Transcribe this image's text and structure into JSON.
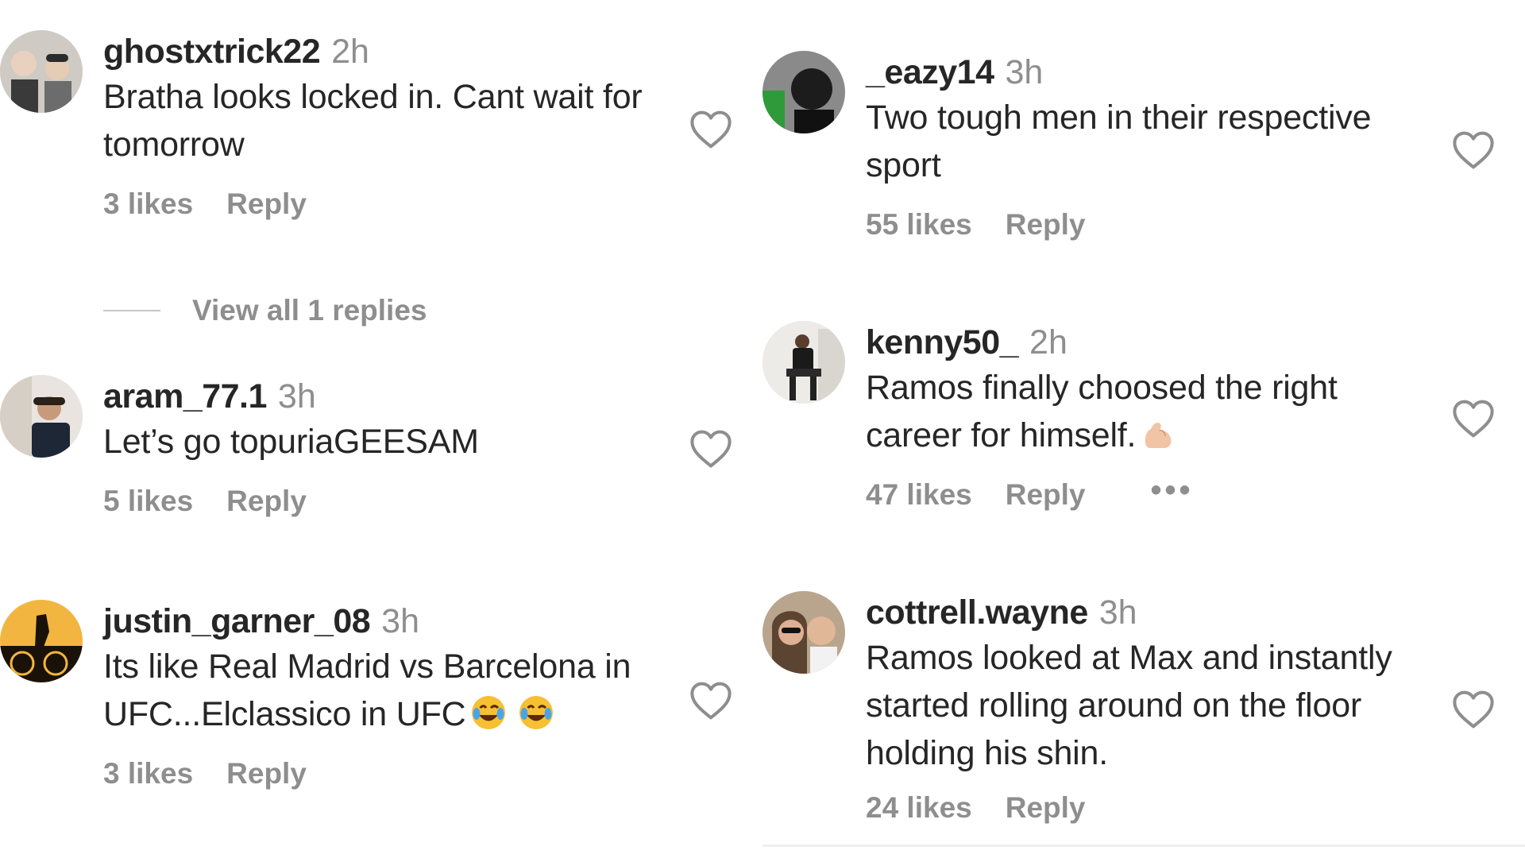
{
  "left_column": {
    "comments": [
      {
        "username": "ghostxtrick22",
        "time": "2h",
        "text": "Bratha looks locked in. Cant wait for tomorrow",
        "likes": "3 likes",
        "reply_label": "Reply",
        "view_replies": "View all 1 replies"
      },
      {
        "username": "aram_77.1",
        "time": "3h",
        "text": "Let’s go topuriaGEESAM",
        "likes": "5 likes",
        "reply_label": "Reply"
      },
      {
        "username": "justin_garner_08",
        "time": "3h",
        "text": "Its like Real Madrid vs Barcelona in UFC...Elclassico in UFC",
        "likes": "3 likes",
        "reply_label": "Reply"
      }
    ]
  },
  "right_column": {
    "comments": [
      {
        "username": "_eazy14",
        "time": "3h",
        "text": "Two tough men in their respective sport",
        "likes": "55 likes",
        "reply_label": "Reply"
      },
      {
        "username": "kenny50_",
        "time": "2h",
        "text": "Ramos finally choosed the right career for himself.",
        "likes": "47 likes",
        "reply_label": "Reply",
        "more_label": "•••"
      },
      {
        "username": "cottrell.wayne",
        "time": "3h",
        "text": "Ramos looked at Max and instantly started rolling around on the floor holding his shin.",
        "likes": "24 likes",
        "reply_label": "Reply"
      }
    ]
  },
  "icons": {
    "like": "heart-outline-icon",
    "laugh_emoji": "tears-of-joy-emoji",
    "flexed_biceps_emoji": "flexed-biceps-emoji"
  },
  "colors": {
    "text_primary": "#262626",
    "text_secondary": "#8e8e8e"
  }
}
